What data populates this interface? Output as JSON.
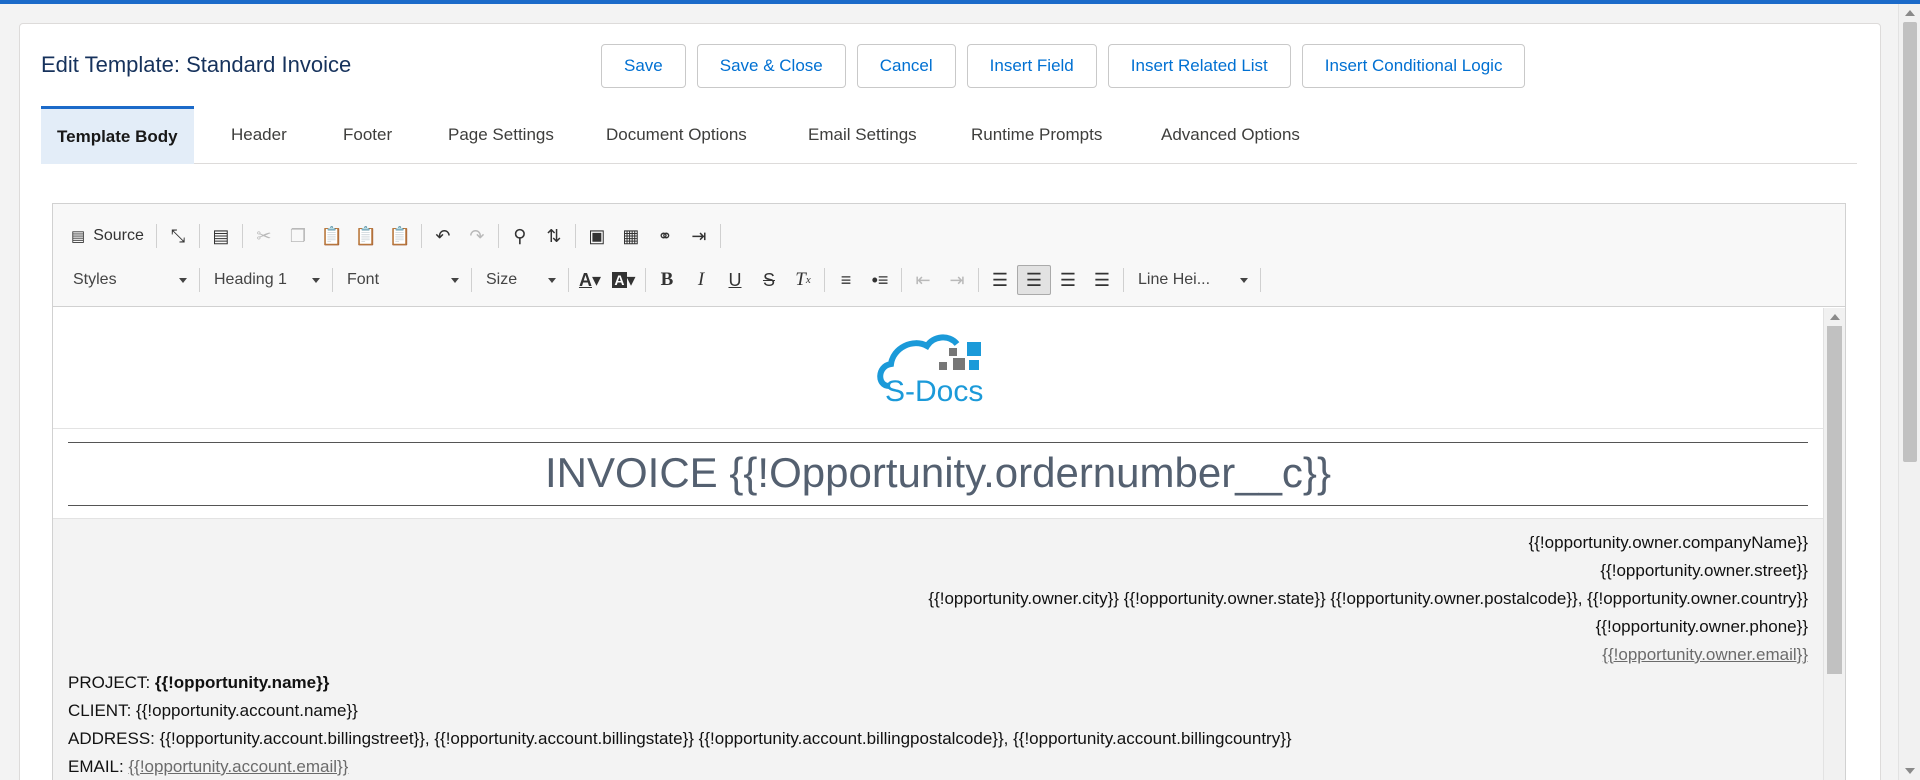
{
  "title": "Edit Template: Standard Invoice",
  "buttons": {
    "save": "Save",
    "save_close": "Save & Close",
    "cancel": "Cancel",
    "insert_field": "Insert Field",
    "insert_related_list": "Insert Related List",
    "insert_conditional_logic": "Insert Conditional Logic"
  },
  "tabs": {
    "template_body": "Template Body",
    "header": "Header",
    "footer": "Footer",
    "page_settings": "Page Settings",
    "document_options": "Document Options",
    "email_settings": "Email Settings",
    "runtime_prompts": "Runtime Prompts",
    "advanced_options": "Advanced Options"
  },
  "toolbar": {
    "source": "Source",
    "styles": "Styles",
    "format": "Heading 1",
    "font": "Font",
    "size": "Size",
    "line_height": "Line Hei..."
  },
  "logo": {
    "text": "S-Docs",
    "colors": {
      "blue": "#1b9ad9",
      "grey": "#777777"
    }
  },
  "invoice_heading": "INVOICE {{!Opportunity.ordernumber__c}}",
  "owner": {
    "company": "{{!opportunity.owner.companyName}}",
    "street": "{{!opportunity.owner.street}}",
    "city_line": "{{!opportunity.owner.city}} {{!opportunity.owner.state}} {{!opportunity.owner.postalcode}}, {{!opportunity.owner.country}}",
    "phone": "{{!opportunity.owner.phone}}",
    "email": "{{!opportunity.owner.email}}"
  },
  "details": {
    "project_label": "PROJECT: ",
    "project_value": "{{!opportunity.name}}",
    "client_label": "CLIENT: ",
    "client_value": "{{!opportunity.account.name}}",
    "address_label": "ADDRESS: ",
    "address_value": "{{!opportunity.account.billingstreet}}, {{!opportunity.account.billingstate}} {{!opportunity.account.billingpostalcode}}, {{!opportunity.account.billingcountry}}",
    "email_label": "EMAIL: ",
    "email_value": "{{!opportunity.account.email}}"
  },
  "colors": {
    "accent": "#1b6ac9",
    "link": "#0070d2",
    "title": "#16325c"
  }
}
